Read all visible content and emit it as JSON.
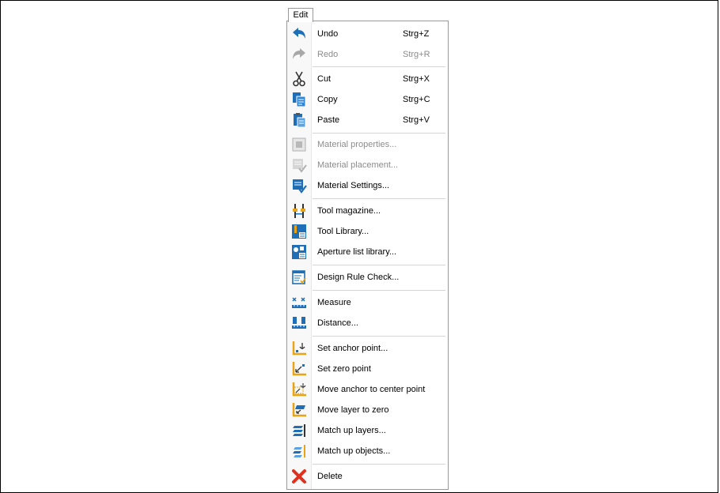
{
  "menu_tab": "Edit",
  "items": {
    "undo": {
      "label": "Undo",
      "shortcut": "Strg+Z"
    },
    "redo": {
      "label": "Redo",
      "shortcut": "Strg+R"
    },
    "cut": {
      "label": "Cut",
      "shortcut": "Strg+X"
    },
    "copy": {
      "label": "Copy",
      "shortcut": "Strg+C"
    },
    "paste": {
      "label": "Paste",
      "shortcut": "Strg+V"
    },
    "material_properties": {
      "label": "Material properties..."
    },
    "material_placement": {
      "label": "Material placement..."
    },
    "material_settings": {
      "label": "Material Settings..."
    },
    "tool_magazine": {
      "label": "Tool magazine..."
    },
    "tool_library": {
      "label": "Tool Library..."
    },
    "aperture_list_library": {
      "label": "Aperture list library..."
    },
    "design_rule_check": {
      "label": "Design Rule Check..."
    },
    "measure": {
      "label": "Measure"
    },
    "distance": {
      "label": "Distance..."
    },
    "set_anchor_point": {
      "label": "Set anchor point..."
    },
    "set_zero_point": {
      "label": "Set zero point"
    },
    "move_anchor_to_center": {
      "label": "Move anchor to center point"
    },
    "move_layer_to_zero": {
      "label": "Move layer to zero"
    },
    "match_up_layers": {
      "label": "Match up layers..."
    },
    "match_up_objects": {
      "label": "Match up objects..."
    },
    "delete": {
      "label": "Delete"
    }
  },
  "colors": {
    "icon_blue": "#1e6fb8",
    "disabled_text": "#8c8c8c",
    "delete_red": "#e0301e",
    "axis_orange": "#e8a317"
  }
}
